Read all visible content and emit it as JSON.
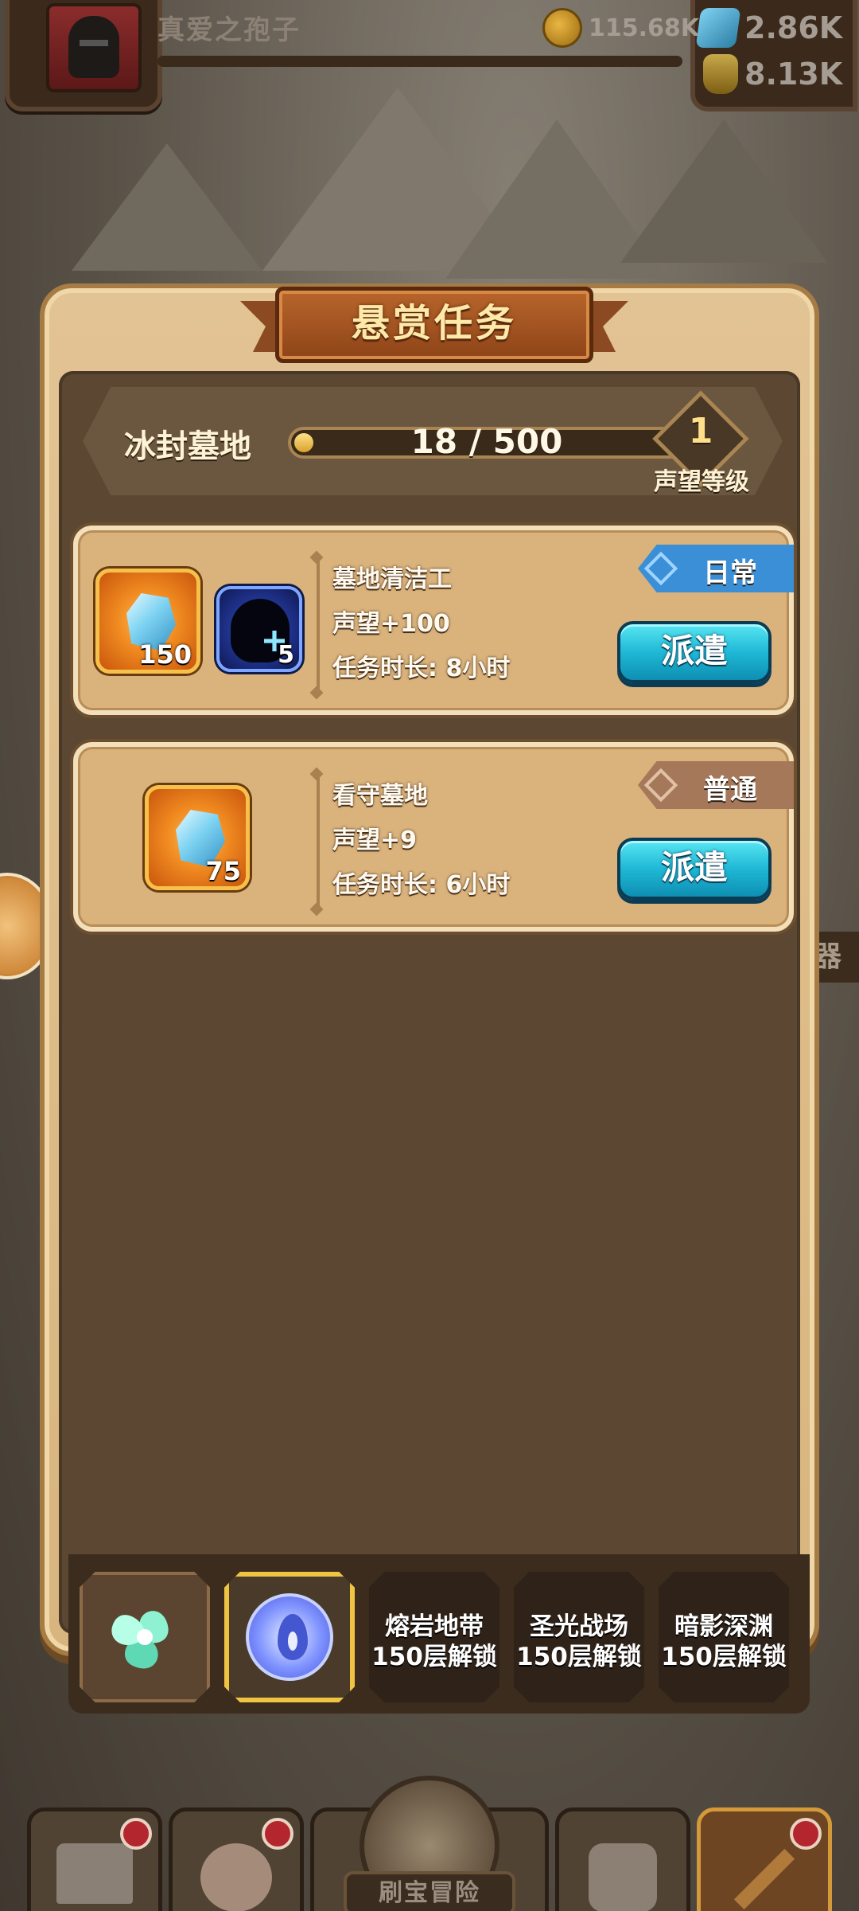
{
  "header": {
    "player_name": "真爱之孢子",
    "gold": "115.68K",
    "gems": "2.86K",
    "potions": "8.13K"
  },
  "dialog": {
    "title": "悬赏任务",
    "region_name": "冰封墓地",
    "reputation_progress_text": "18 / 500",
    "reputation_progress": {
      "current": 18,
      "max": 500
    },
    "reputation_level": "1",
    "reputation_level_label": "声望等级"
  },
  "tasks": [
    {
      "name": "墓地清洁工",
      "reputation": "声望+100",
      "duration": "任务时长: 8小时",
      "tag": "日常",
      "tag_color": "#3a8fd6",
      "button": "派遣",
      "rewards": [
        {
          "icon": "ice-crystal-icon",
          "qty": "150"
        },
        {
          "icon": "hero-shard-icon",
          "qty": "5"
        }
      ]
    },
    {
      "name": "看守墓地",
      "reputation": "声望+9",
      "duration": "任务时长: 6小时",
      "tag": "普通",
      "tag_color": "#a5785a",
      "button": "派遣",
      "rewards": [
        {
          "icon": "ice-crystal-icon",
          "qty": "75"
        }
      ]
    }
  ],
  "region_tabs": [
    {
      "icon": "wind-swirl-icon",
      "state": "unlocked"
    },
    {
      "icon": "water-drop-icon",
      "state": "selected"
    },
    {
      "name": "熔岩地带",
      "lock_text": "150层解锁",
      "state": "locked"
    },
    {
      "name": "圣光战场",
      "lock_text": "150层解锁",
      "state": "locked"
    },
    {
      "name": "暗影深渊",
      "lock_text": "150层解锁",
      "state": "locked"
    }
  ],
  "side": {
    "right_label": "器"
  },
  "bottom_nav": {
    "adventure_label": "刷宝冒险",
    "items": [
      "shop-icon",
      "hero-icon",
      "adventure-icon",
      "bag-icon",
      "forge-icon"
    ]
  },
  "colors": {
    "accent_gold": "#f0c443",
    "dispatch_button": "#1fb8d6",
    "panel": "#5c4733",
    "alert_dot": "#b4262e"
  }
}
